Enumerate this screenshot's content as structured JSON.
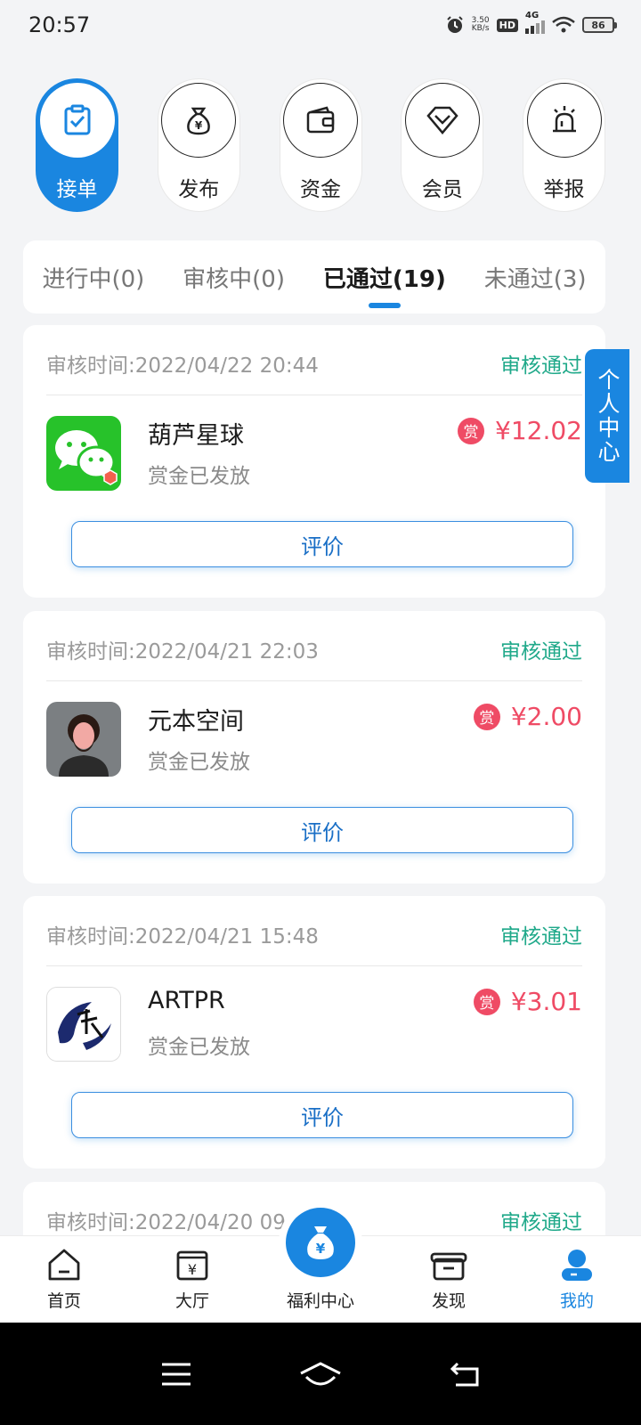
{
  "status_bar": {
    "time": "20:57",
    "net_speed_value": "3.50",
    "net_speed_unit": "KB/s",
    "hd": "HD",
    "network": "4G",
    "battery": "86"
  },
  "top_nav": [
    {
      "label": "接单",
      "icon": "clipboard-check-icon",
      "active": true
    },
    {
      "label": "发布",
      "icon": "money-bag-icon",
      "active": false
    },
    {
      "label": "资金",
      "icon": "wallet-icon",
      "active": false
    },
    {
      "label": "会员",
      "icon": "diamond-icon",
      "active": false
    },
    {
      "label": "举报",
      "icon": "alarm-light-icon",
      "active": false
    }
  ],
  "tabs": [
    {
      "label": "进行中(0)",
      "active": false
    },
    {
      "label": "审核中(0)",
      "active": false
    },
    {
      "label": "已通过(19)",
      "active": true
    },
    {
      "label": "未通过(3)",
      "active": false
    }
  ],
  "orders": [
    {
      "review_time": "审核时间:2022/04/22 20:44",
      "status": "审核通过",
      "app_name": "葫芦星球",
      "pay_status": "赏金已发放",
      "reward_badge": "赏",
      "amount": "¥12.02",
      "button": "评价",
      "icon": "wechat-app-icon"
    },
    {
      "review_time": "审核时间:2022/04/21 22:03",
      "status": "审核通过",
      "app_name": "元本空间",
      "pay_status": "赏金已发放",
      "reward_badge": "赏",
      "amount": "¥2.00",
      "button": "评价",
      "icon": "avatar-app-icon"
    },
    {
      "review_time": "审核时间:2022/04/21 15:48",
      "status": "审核通过",
      "app_name": "ARTPR",
      "pay_status": "赏金已发放",
      "reward_badge": "赏",
      "amount": "¥3.01",
      "button": "评价",
      "icon": "artpr-app-icon"
    },
    {
      "review_time": "审核时间:2022/04/20 09",
      "status": "审核通过"
    }
  ],
  "float_tab": {
    "label": "个人中心"
  },
  "bottom_nav": [
    {
      "label": "首页",
      "icon": "home-icon"
    },
    {
      "label": "大厅",
      "icon": "hall-icon"
    },
    {
      "label": "福利中心",
      "icon": "money-bag-icon"
    },
    {
      "label": "发现",
      "icon": "gift-box-icon"
    },
    {
      "label": "我的",
      "icon": "user-icon",
      "active": true
    }
  ],
  "colors": {
    "accent": "#1a86e0",
    "success": "#20a98a",
    "reward": "#ef4b65",
    "background": "#f3f4f6"
  }
}
